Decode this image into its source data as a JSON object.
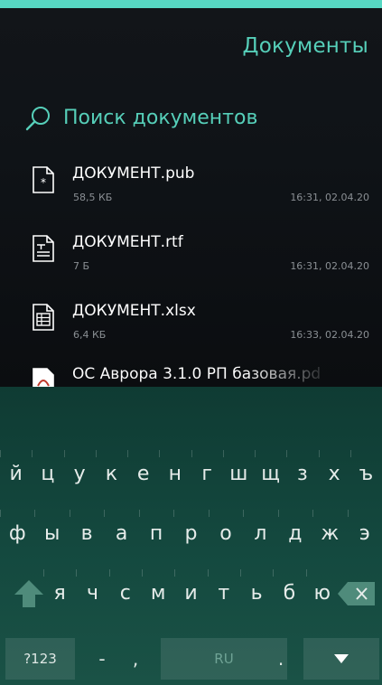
{
  "header": {
    "title": "Документы"
  },
  "search": {
    "placeholder": "Поиск документов"
  },
  "documents": [
    {
      "name": "ДОКУМЕНТ.pub",
      "size": "58,5 КБ",
      "modified": "16:31, 02.04.20",
      "icon": "pub-file-icon"
    },
    {
      "name": "ДОКУМЕНТ.rtf",
      "size": "7 Б",
      "modified": "16:31, 02.04.20",
      "icon": "rtf-file-icon"
    },
    {
      "name": "ДОКУМЕНТ.xlsx",
      "size": "6,4 КБ",
      "modified": "16:33, 02.04.20",
      "icon": "xlsx-file-icon"
    }
  ],
  "partial_document": {
    "name": "ОС Аврора 3.1.0 РП базовая.pd",
    "icon": "pdf-file-icon"
  },
  "keyboard": {
    "row1": [
      "й",
      "ц",
      "у",
      "к",
      "е",
      "н",
      "г",
      "ш",
      "щ",
      "з",
      "х",
      "ъ"
    ],
    "row2": [
      "ф",
      "ы",
      "в",
      "а",
      "п",
      "р",
      "о",
      "л",
      "д",
      "ж",
      "э"
    ],
    "row3": [
      "я",
      "ч",
      "с",
      "м",
      "и",
      "т",
      "ь",
      "б",
      "ю"
    ],
    "symbols_label": "?123",
    "dash_label": "-",
    "comma_label": ",",
    "space_label": "RU",
    "dot_label": "."
  },
  "colors": {
    "accent": "#56cfb9",
    "keyboard_bg": "#14493f"
  }
}
